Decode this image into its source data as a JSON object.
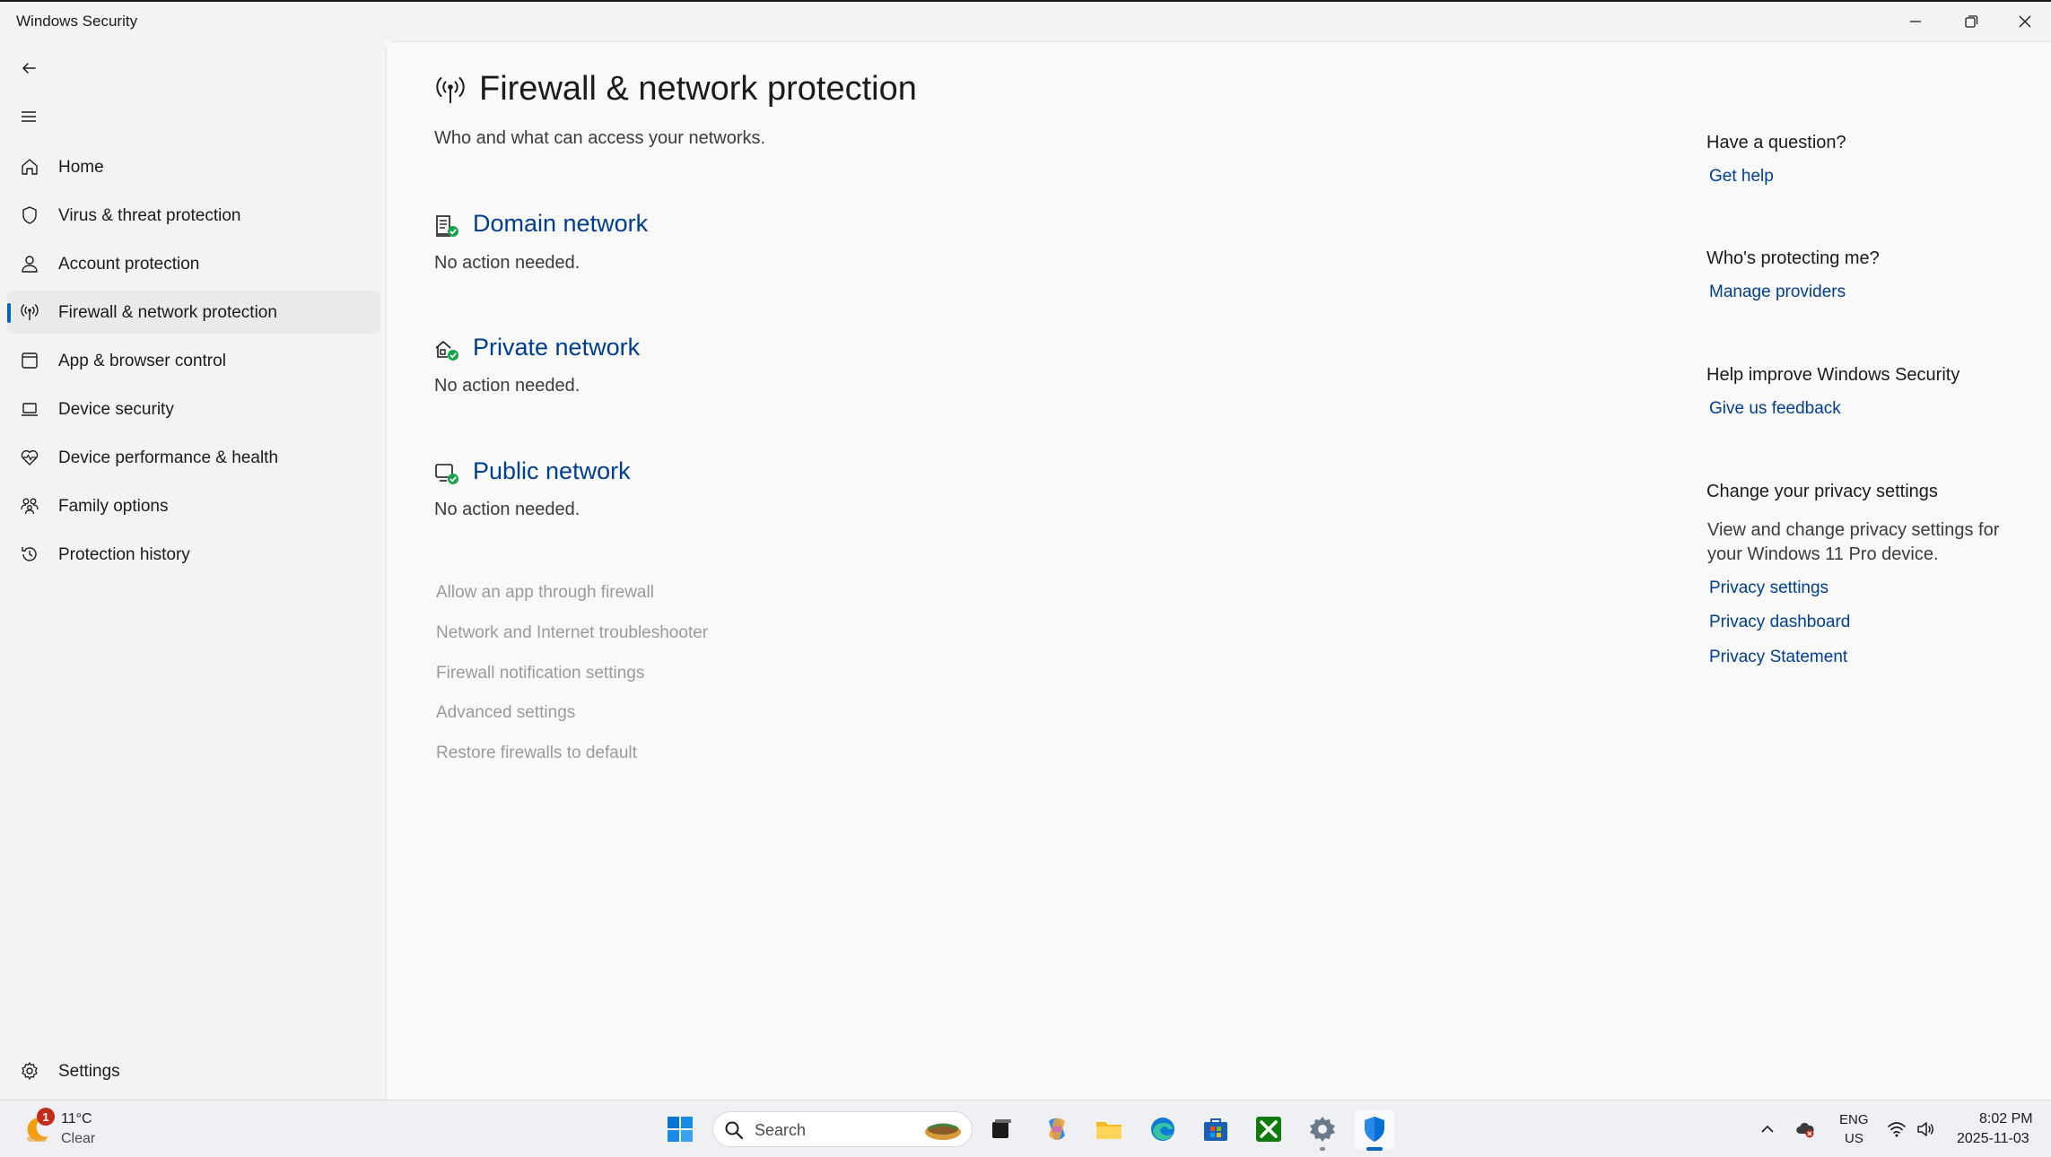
{
  "window": {
    "title": "Windows Security",
    "minimize_icon": "minimize-icon",
    "restore_icon": "restore-icon",
    "close_icon": "close-icon"
  },
  "sidebar": {
    "back_icon": "back-arrow-icon",
    "menu_icon": "hamburger-menu-icon",
    "items": [
      {
        "label": "Home",
        "icon": "home-icon"
      },
      {
        "label": "Virus & threat protection",
        "icon": "shield-icon"
      },
      {
        "label": "Account protection",
        "icon": "person-icon"
      },
      {
        "label": "Firewall & network protection",
        "icon": "antenna-icon",
        "selected": true
      },
      {
        "label": "App & browser control",
        "icon": "app-window-icon"
      },
      {
        "label": "Device security",
        "icon": "laptop-icon"
      },
      {
        "label": "Device performance & health",
        "icon": "heart-pulse-icon"
      },
      {
        "label": "Family options",
        "icon": "family-icon"
      },
      {
        "label": "Protection history",
        "icon": "history-icon"
      }
    ],
    "settings": {
      "label": "Settings",
      "icon": "gear-icon"
    }
  },
  "main": {
    "title": "Firewall & network protection",
    "title_icon": "antenna-icon",
    "subtitle": "Who and what can access your networks.",
    "networks": [
      {
        "name": "Domain network",
        "status": "No action needed.",
        "icon": "domain-network-icon"
      },
      {
        "name": "Private network",
        "status": "No action needed.",
        "icon": "private-network-icon"
      },
      {
        "name": "Public network",
        "status": "No action needed.",
        "icon": "public-network-icon"
      }
    ],
    "links": [
      "Allow an app through firewall",
      "Network and Internet troubleshooter",
      "Firewall notification settings",
      "Advanced settings",
      "Restore firewalls to default"
    ]
  },
  "right": {
    "question_heading": "Have a question?",
    "get_help": "Get help",
    "protecting_heading": "Who's protecting me?",
    "manage_providers": "Manage providers",
    "improve_heading": "Help improve Windows Security",
    "feedback": "Give us feedback",
    "privacy_heading": "Change your privacy settings",
    "privacy_text": "View and change privacy settings for your Windows 11 Pro device.",
    "privacy_settings": "Privacy settings",
    "privacy_dashboard": "Privacy dashboard",
    "privacy_statement": "Privacy Statement"
  },
  "taskbar": {
    "weather_badge": "1",
    "weather_temp": "11°C",
    "weather_condition": "Clear",
    "search_placeholder": "Search",
    "pinned_icons": [
      "start-icon",
      "task-view-icon",
      "copilot-icon",
      "file-explorer-icon",
      "edge-icon",
      "store-icon",
      "xbox-icon",
      "settings-icon",
      "windows-security-icon"
    ],
    "language_primary": "ENG",
    "language_secondary": "US",
    "time": "8:02 PM",
    "date": "2025-11-03"
  },
  "colors": {
    "accent": "#0067c0",
    "link": "#003e92",
    "ok_green": "#16a34a",
    "sidebar_bg": "#f3f3f3",
    "content_bg": "#f9f9f9"
  }
}
